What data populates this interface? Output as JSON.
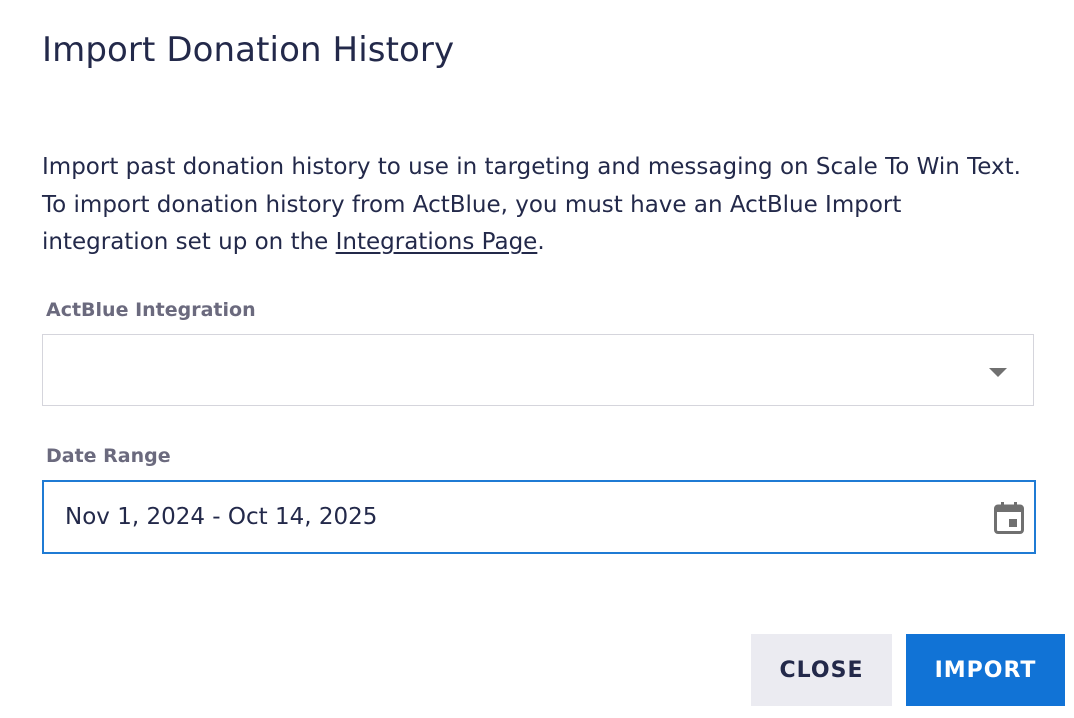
{
  "dialog": {
    "title": "Import Donation History",
    "description": {
      "text_before_link": "Import past donation history to use in targeting and messaging on Scale To Win Text. To import donation history from ActBlue, you must have an ActBlue Import integration set up on the ",
      "link_text": "Integrations Page",
      "text_after_link": "."
    },
    "actblue_integration": {
      "label": "ActBlue Integration",
      "selected_value": "",
      "icon": "chevron-down-icon"
    },
    "date_range": {
      "label": "Date Range",
      "value": "Nov 1, 2024 - Oct 14, 2025",
      "icon": "calendar-icon",
      "focused": true
    },
    "buttons": {
      "close_label": "CLOSE",
      "import_label": "IMPORT"
    },
    "colors": {
      "text": "#23294a",
      "label": "#6b6a7e",
      "focus_border": "#1f7bd4",
      "primary_button": "#1173d6",
      "secondary_button": "#ebebf1"
    }
  }
}
